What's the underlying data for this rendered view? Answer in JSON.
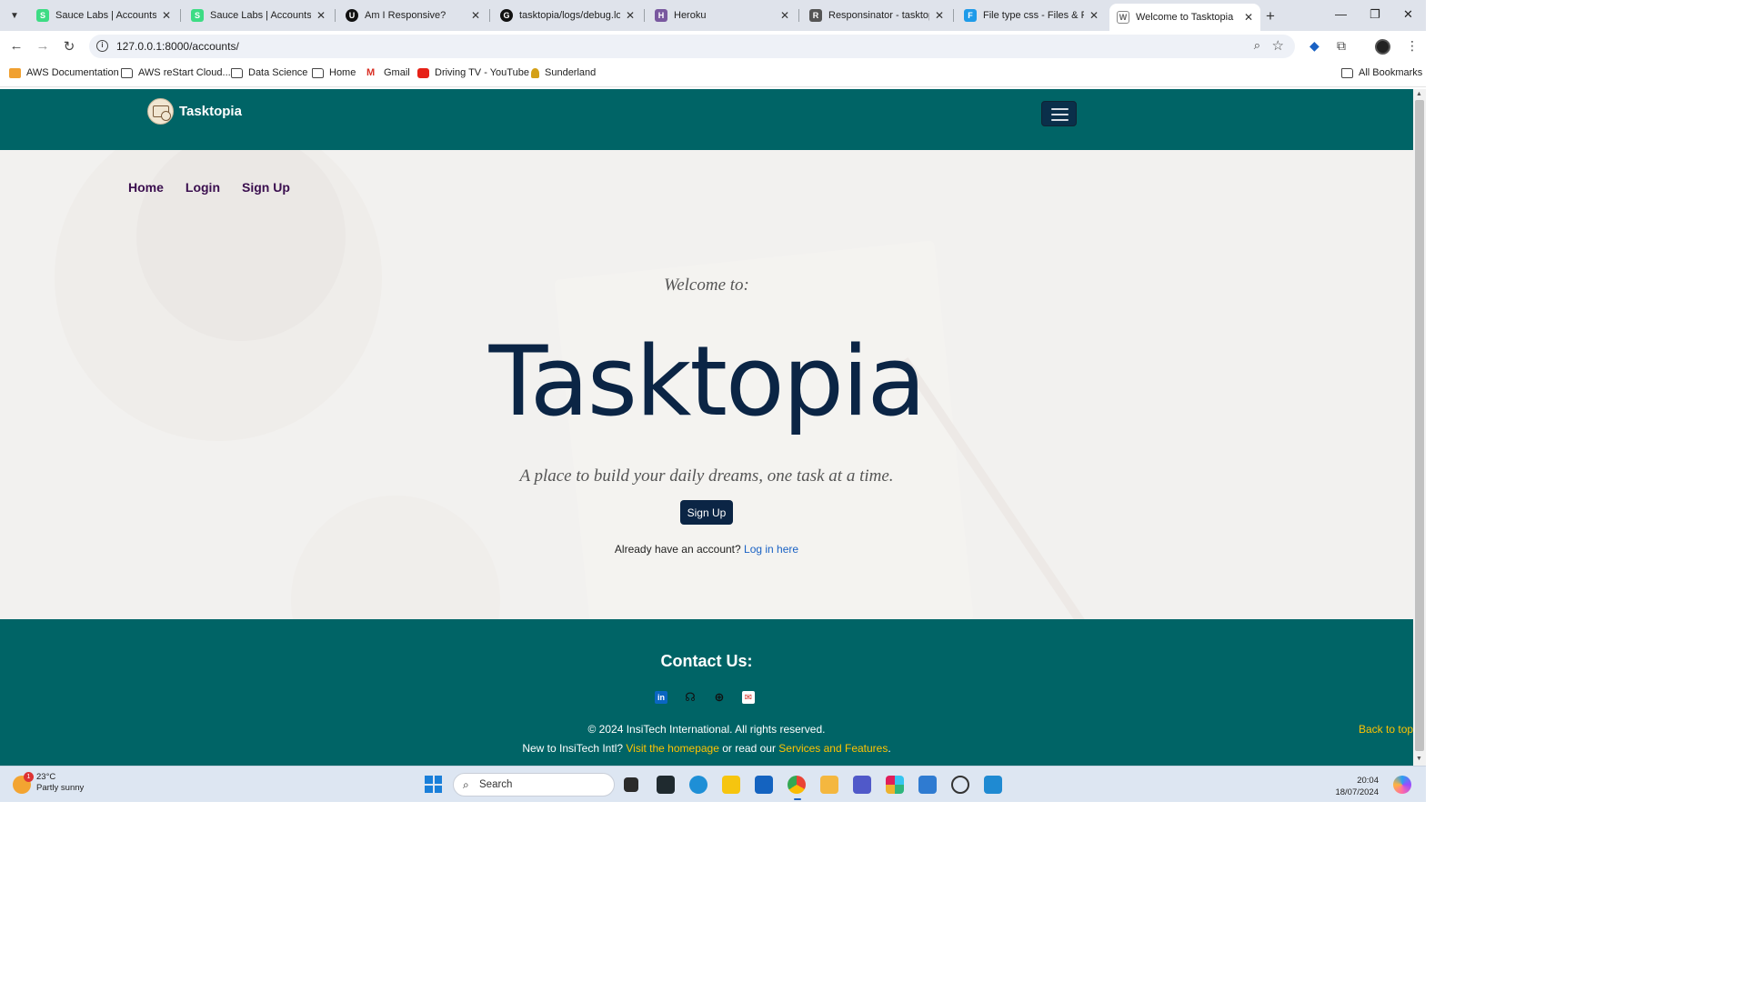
{
  "browser": {
    "tabs": [
      {
        "title": "Sauce Labs | Accounts",
        "fav_color": "#3ddc84",
        "fav_glyph": "S"
      },
      {
        "title": "Sauce Labs | Accounts",
        "fav_color": "#3ddc84",
        "fav_glyph": "S"
      },
      {
        "title": "Am I Responsive?",
        "fav_color": "#111111",
        "fav_glyph": "U"
      },
      {
        "title": "tasktopia/logs/debug.log",
        "fav_color": "#111111",
        "fav_glyph": "G"
      },
      {
        "title": "Heroku",
        "fav_color": "#79589f",
        "fav_glyph": "H"
      },
      {
        "title": "Responsinator - tasktopia",
        "fav_color": "#555555",
        "fav_glyph": "R"
      },
      {
        "title": "File type css - Files & Folders",
        "fav_color": "#1e9be9",
        "fav_glyph": "F"
      },
      {
        "title": "Welcome to Tasktopia",
        "fav_color": "#888888",
        "fav_glyph": "W"
      }
    ],
    "url": "127.0.0.1:8000/accounts/",
    "bookmarks": [
      {
        "label": "AWS Documentation",
        "icon": "aws-icon"
      },
      {
        "label": "AWS reStart Cloud...",
        "icon": "folder-icon"
      },
      {
        "label": "Data Science",
        "icon": "folder-icon"
      },
      {
        "label": "Home",
        "icon": "folder-icon"
      },
      {
        "label": "Gmail",
        "icon": "gmail-icon"
      },
      {
        "label": "Driving TV - YouTube",
        "icon": "youtube-icon"
      },
      {
        "label": "Sunderland",
        "icon": "sunderland-icon"
      }
    ],
    "all_bookmarks": "All Bookmarks"
  },
  "site": {
    "brand": "Tasktopia",
    "nav": {
      "home": "Home",
      "login": "Login",
      "signup": "Sign Up"
    },
    "hero": {
      "welcome": "Welcome to:",
      "title": "Tasktopia",
      "tagline": "A place to build your daily dreams, one task at a time.",
      "signup_button": "Sign Up",
      "already_text": "Already have an account?",
      "login_link": "Log in here"
    },
    "footer": {
      "contact": "Contact Us:",
      "copyright": "© 2024 InsiTech International. All rights reserved.",
      "new_to": "New to InsiTech Intl?",
      "homepage_link": "Visit the homepage",
      "or_read": "or read our",
      "services_link": "Services and Features",
      "period": ".",
      "back_to_top": "Back to top"
    },
    "colors": {
      "primary": "#006466",
      "dark": "#0b2545",
      "accent": "#ffc300",
      "nav_link": "#3a0e4e"
    }
  },
  "taskbar": {
    "weather_temp": "23°C",
    "weather_desc": "Partly sunny",
    "weather_badge": "1",
    "search": "Search",
    "time": "20:04",
    "date": "18/07/2024"
  }
}
